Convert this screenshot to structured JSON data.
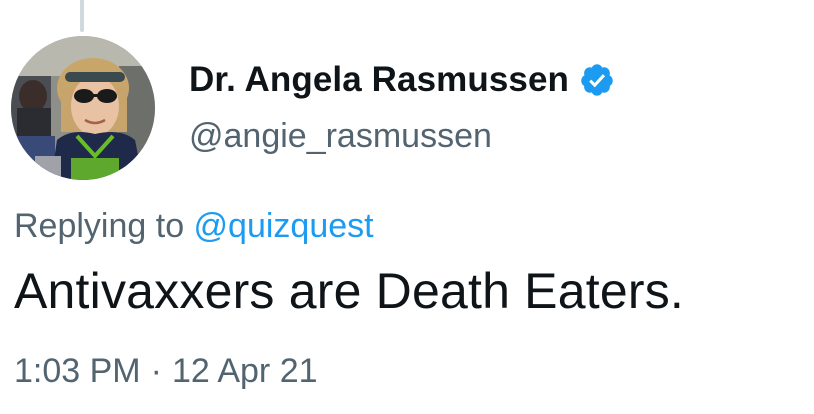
{
  "author": {
    "display_name": "Dr. Angela Rasmussen",
    "handle": "@angie_rasmussen",
    "verified": true,
    "avatar_icon": "profile-photo"
  },
  "reply": {
    "prefix": "Replying to",
    "target_handle": "@quizquest"
  },
  "tweet": {
    "text": "Antivaxxers are Death Eaters.",
    "time": "1:03 PM",
    "separator": "·",
    "date": "12 Apr 21"
  },
  "colors": {
    "accent": "#1d9bf0",
    "secondary_text": "#536471",
    "primary_text": "#0f1419",
    "thread_line": "#cfd9de"
  }
}
